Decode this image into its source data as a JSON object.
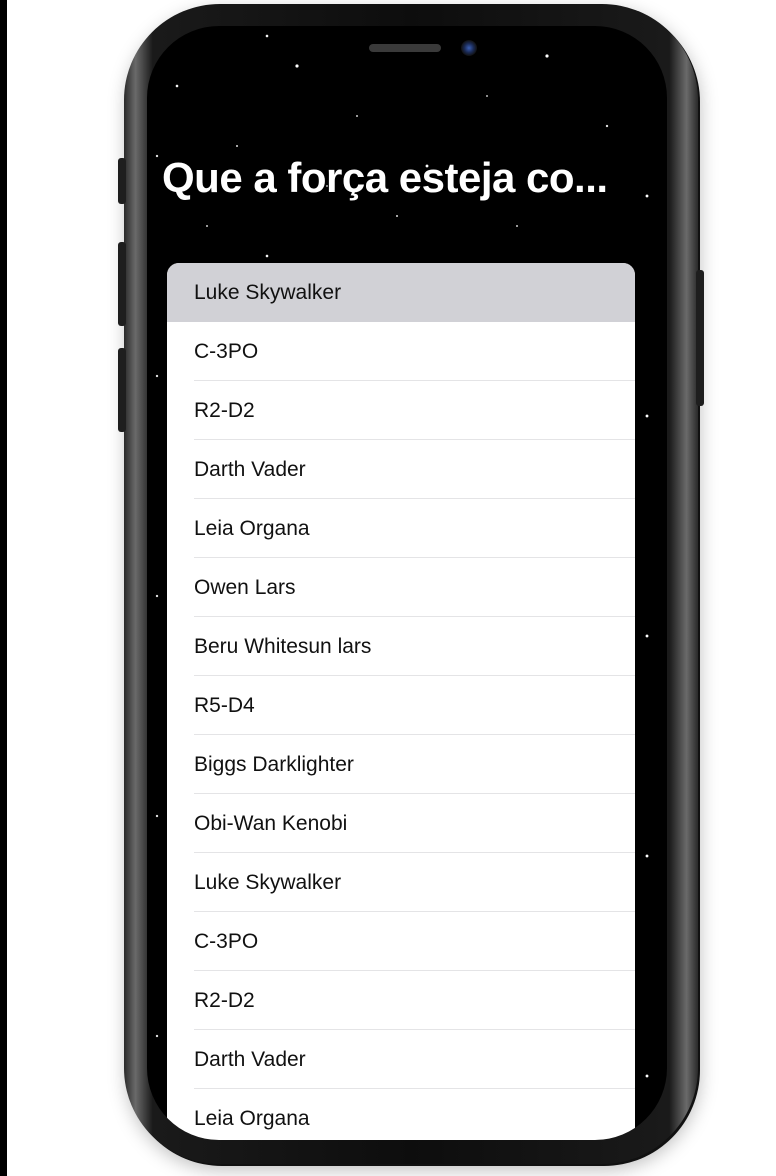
{
  "screen": {
    "title": "Que a força esteja co..."
  },
  "list": {
    "selected_index": 0,
    "items": [
      {
        "label": "Luke Skywalker"
      },
      {
        "label": "C-3PO"
      },
      {
        "label": "R2-D2"
      },
      {
        "label": "Darth Vader"
      },
      {
        "label": "Leia Organa"
      },
      {
        "label": "Owen Lars"
      },
      {
        "label": "Beru Whitesun lars"
      },
      {
        "label": "R5-D4"
      },
      {
        "label": "Biggs Darklighter"
      },
      {
        "label": "Obi-Wan Kenobi"
      },
      {
        "label": "Luke Skywalker"
      },
      {
        "label": "C-3PO"
      },
      {
        "label": "R2-D2"
      },
      {
        "label": "Darth Vader"
      },
      {
        "label": "Leia Organa"
      }
    ]
  },
  "colors": {
    "background": "#000000",
    "title": "#ffffff",
    "list_background": "#ffffff",
    "selected_row": "#d1d1d6",
    "separator": "#e4e4e6"
  }
}
